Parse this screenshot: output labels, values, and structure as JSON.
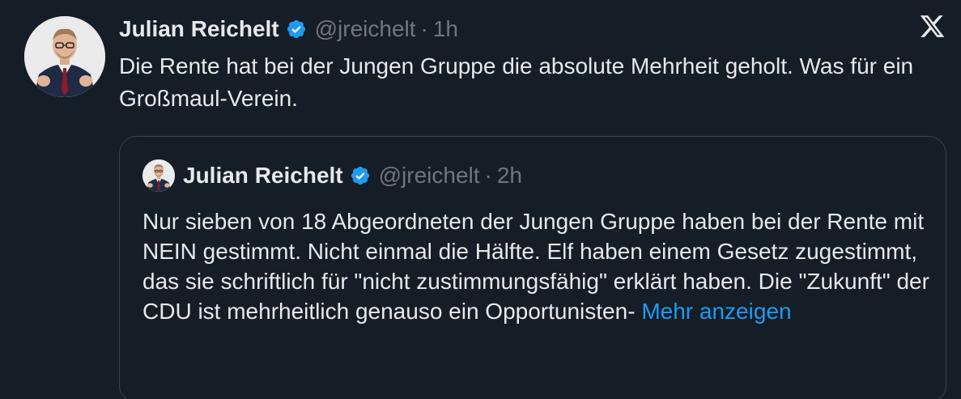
{
  "tweet": {
    "author_name": "Julian Reichelt",
    "handle": "@jreichelt",
    "separator": "·",
    "time": "1h",
    "text": "Die Rente hat bei der Jungen Gruppe die absolute Mehrheit geholt. Was für ein Großmaul-Verein.",
    "verified_icon": "verified-badge-icon",
    "platform_icon": "x-logo-icon"
  },
  "quoted_tweet": {
    "author_name": "Julian Reichelt",
    "handle": "@jreichelt",
    "separator": "·",
    "time": "2h",
    "text": "Nur sieben von 18 Abgeordneten der Jungen Gruppe haben bei der Rente mit NEIN gestimmt. Nicht einmal die Hälfte. Elf haben einem Gesetz zugestimmt, das sie schriftlich für \"nicht zustimmungsfähig\" erklärt haben. Die \"Zukunft\" der CDU ist mehrheitlich genauso ein Opportunisten- ",
    "more_link": "Mehr anzeigen"
  },
  "colors": {
    "background": "#151d27",
    "text": "#e7e9ea",
    "muted": "#71767b",
    "accent": "#1d9bf0",
    "border": "#3a424b"
  }
}
